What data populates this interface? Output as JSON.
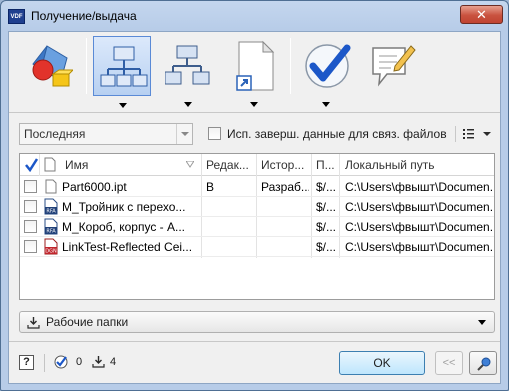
{
  "window": {
    "title": "Получение/выдача",
    "app_icon_text": "VDF",
    "close_glyph": "✕"
  },
  "toolbar": {
    "buttons": [
      {
        "icon": "3d-shapes-icon"
      },
      {
        "icon": "network-tree-icon",
        "active": true
      },
      {
        "icon": "hierarchy-icon"
      },
      {
        "icon": "document-shortcut-icon"
      },
      {
        "icon": "checkmark-icon"
      },
      {
        "icon": "comment-edit-icon"
      }
    ]
  },
  "options": {
    "version_combo_value": "Последняя",
    "use_checkin_data_label": "Исп. заверш. данные для связ. файлов",
    "use_checkin_data_checked": false
  },
  "grid": {
    "columns": [
      "Имя",
      "Редак...",
      "Истор...",
      "П...",
      "Локальный путь"
    ],
    "rows": [
      {
        "name": "Part6000.ipt",
        "edit": "В",
        "history": "Разраб...",
        "p": "$/...",
        "local_path": "C:\\Users\\фвышт\\Documen...",
        "icon": "ipt"
      },
      {
        "name": "М_Тройник с перехо...",
        "edit": "",
        "history": "",
        "p": "$/...",
        "local_path": "C:\\Users\\фвышт\\Documen...",
        "icon": "rfa"
      },
      {
        "name": "М_Короб, корпус - А...",
        "edit": "",
        "history": "",
        "p": "$/...",
        "local_path": "C:\\Users\\фвышт\\Documen...",
        "icon": "rfa"
      },
      {
        "name": "LinkTest-Reflected Cei...",
        "edit": "",
        "history": "",
        "p": "$/...",
        "local_path": "C:\\Users\\фвышт\\Documen...",
        "icon": "dgn"
      }
    ]
  },
  "folder_combo": {
    "value": "Рабочие папки"
  },
  "status": {
    "help_label": "?",
    "checked_count": "0",
    "download_count": "4",
    "ok_label": "OK",
    "back_label": "<<"
  },
  "colors": {
    "accent": "#2a62b8",
    "check_blue": "#1c57c8",
    "titlebar": "#c4d6ee"
  }
}
